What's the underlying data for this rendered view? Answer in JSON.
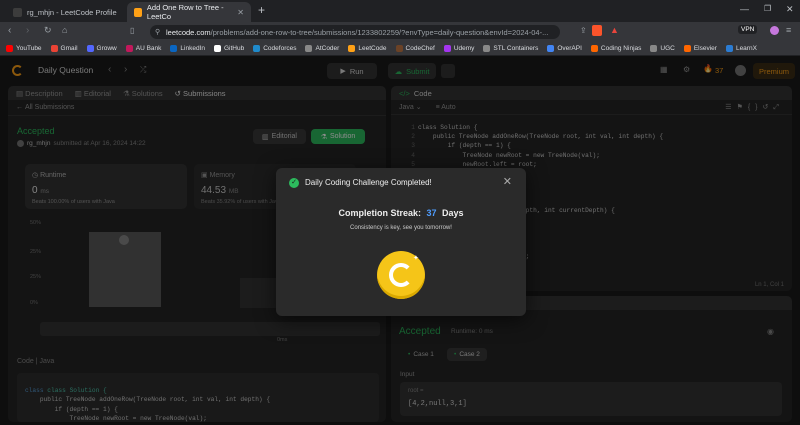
{
  "browser": {
    "tabs": [
      {
        "label": "rg_mhjn - LeetCode Profile"
      },
      {
        "label": "Add One Row to Tree - LeetCo"
      }
    ],
    "new_tab": "+",
    "url_host": "leetcode.com",
    "url_path": "/problems/add-one-row-to-tree/submissions/1233802259/?envType=daily-question&envId=2024-04-...",
    "vpn": "VPN",
    "bookmarks": [
      "YouTube",
      "Gmail",
      "Groww",
      "AU Bank",
      "LinkedIn",
      "GitHub",
      "Codeforces",
      "AtCoder",
      "LeetCode",
      "CodeChef",
      "Udemy",
      "STL Containers",
      "OverAPI",
      "Coding Ninjas",
      "UGC",
      "Elsevier",
      "LearnX"
    ]
  },
  "lc": {
    "daily": "Daily Question",
    "run": "Run",
    "submit": "Submit",
    "streak_count": "37",
    "premium": "Premium",
    "left_tabs": [
      "Description",
      "Editorial",
      "Solutions",
      "Submissions"
    ],
    "all_submissions": "All Submissions",
    "status": "Accepted",
    "user": "rg_mhjn",
    "submitted": "submitted at Apr 16, 2024 14:22",
    "editorial_btn": "Editorial",
    "solution_btn": "Solution",
    "runtime_label": "Runtime",
    "runtime_val": "0",
    "runtime_unit": "ms",
    "runtime_beats": "Beats 100.00% of users with Java",
    "memory_label": "Memory",
    "memory_val": "44.53",
    "memory_unit": "MB",
    "memory_beats": "Beats 35.92% of users with Java",
    "chart_y": [
      "50%",
      "25%",
      "25%",
      "0%"
    ],
    "chart_x": "0ms",
    "code_lang": "Code | Java",
    "code_label": "Code",
    "lang": "Java",
    "auto": "Auto",
    "left_code": [
      "class Solution {",
      "    public TreeNode addOneRow(TreeNode root, int val, int depth) {",
      "        if (depth == 1) {",
      "            TreeNode newRoot = new TreeNode(val);"
    ],
    "right_code": [
      "class Solution {",
      "    public TreeNode addOneRow(TreeNode root, int val, int depth) {",
      "        if (depth == 1) {",
      "            TreeNode newRoot = new TreeNode(val);",
      "            newRoot.left = root;",
      "",
      "            ));",
      "",
      "",
      "        node, int val, int depth, int currentDepth) {",
      "",
      "",
      "",
      "        pth - 1) {",
      "        d = new TreeNode(val);"
    ],
    "line_numbers": [
      "1",
      "2",
      "3",
      "4",
      "5",
      "6",
      "7",
      "8",
      "9",
      "10",
      "11",
      "12",
      "13",
      "14",
      "15"
    ],
    "cursor": "Ln 1, Col 1",
    "result_status": "Accepted",
    "result_runtime": "Runtime: 0 ms",
    "cases": [
      "Case 1",
      "Case 2"
    ],
    "input_label": "Input",
    "root_label": "root =",
    "root_val": "[4,2,null,3,1]"
  },
  "modal": {
    "title": "Daily Coding Challenge Completed!",
    "streak_label": "Completion Streak:",
    "streak_value": "37",
    "streak_unit": "Days",
    "message": "Consistency is key, see you tomorrow!"
  },
  "colors": {
    "accent_green": "#2cbb5d",
    "coin": "#f5c518",
    "streak_blue": "#4f9dff"
  }
}
